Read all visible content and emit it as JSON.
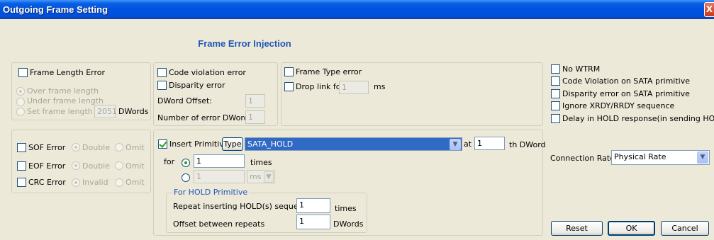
{
  "window": {
    "title": "Outgoing Frame Setting",
    "close_glyph": "X"
  },
  "heading": "Frame Error Injection",
  "frame_length": {
    "label": "Frame Length Error",
    "over": "Over frame length",
    "under": "Under frame length",
    "set_to": "Set frame length to",
    "length_value": "2051",
    "unit": "DWords"
  },
  "code_violation": {
    "code_label": "Code violation error",
    "disparity_label": "Disparity error",
    "offset_label": "DWord Offset:",
    "offset_value": "1",
    "num_label": "Number of error DWords:",
    "num_value": "1"
  },
  "frame_type": {
    "type_label": "Frame Type error",
    "drop_label": "Drop link for",
    "drop_value": "1",
    "drop_unit": "ms"
  },
  "right_options": [
    "No WTRM",
    "Code Violation on SATA primitive",
    "Disparity error on SATA primitive",
    "Ignore XRDY/RRDY sequence",
    "Delay in HOLD response(in sending HOLDA)"
  ],
  "sof": {
    "label": "SOF Error",
    "opt1": "Double",
    "opt2": "Omit"
  },
  "eof": {
    "label": "EOF Error",
    "opt1": "Double",
    "opt2": "Omit"
  },
  "crc": {
    "label": "CRC Error",
    "opt1": "Invalid",
    "opt2": "Omit"
  },
  "insert": {
    "label": "Insert Primitive",
    "type_button": "Type",
    "primitive_value": "SATA_HOLD",
    "at_label": "at",
    "at_value": "1",
    "dword_label": "th DWord",
    "for_label": "for",
    "times_value": "1",
    "times_label": "times",
    "ms_value": "1",
    "ms_unit": "ms"
  },
  "hold": {
    "title": "For HOLD Primitive",
    "repeat_label": "Repeat inserting HOLD(s) sequence",
    "repeat_value": "1",
    "repeat_unit": "times",
    "offset_label": "Offset between repeats",
    "offset_value": "1",
    "offset_unit": "DWords"
  },
  "connection": {
    "label": "Connection Rate",
    "value": "Physical Rate"
  },
  "buttons": {
    "reset": "Reset",
    "ok": "OK",
    "cancel": "Cancel"
  },
  "colors": {
    "accent": "#1f57b8",
    "title_bar": "#0053e1",
    "selection": "#316ac5"
  }
}
